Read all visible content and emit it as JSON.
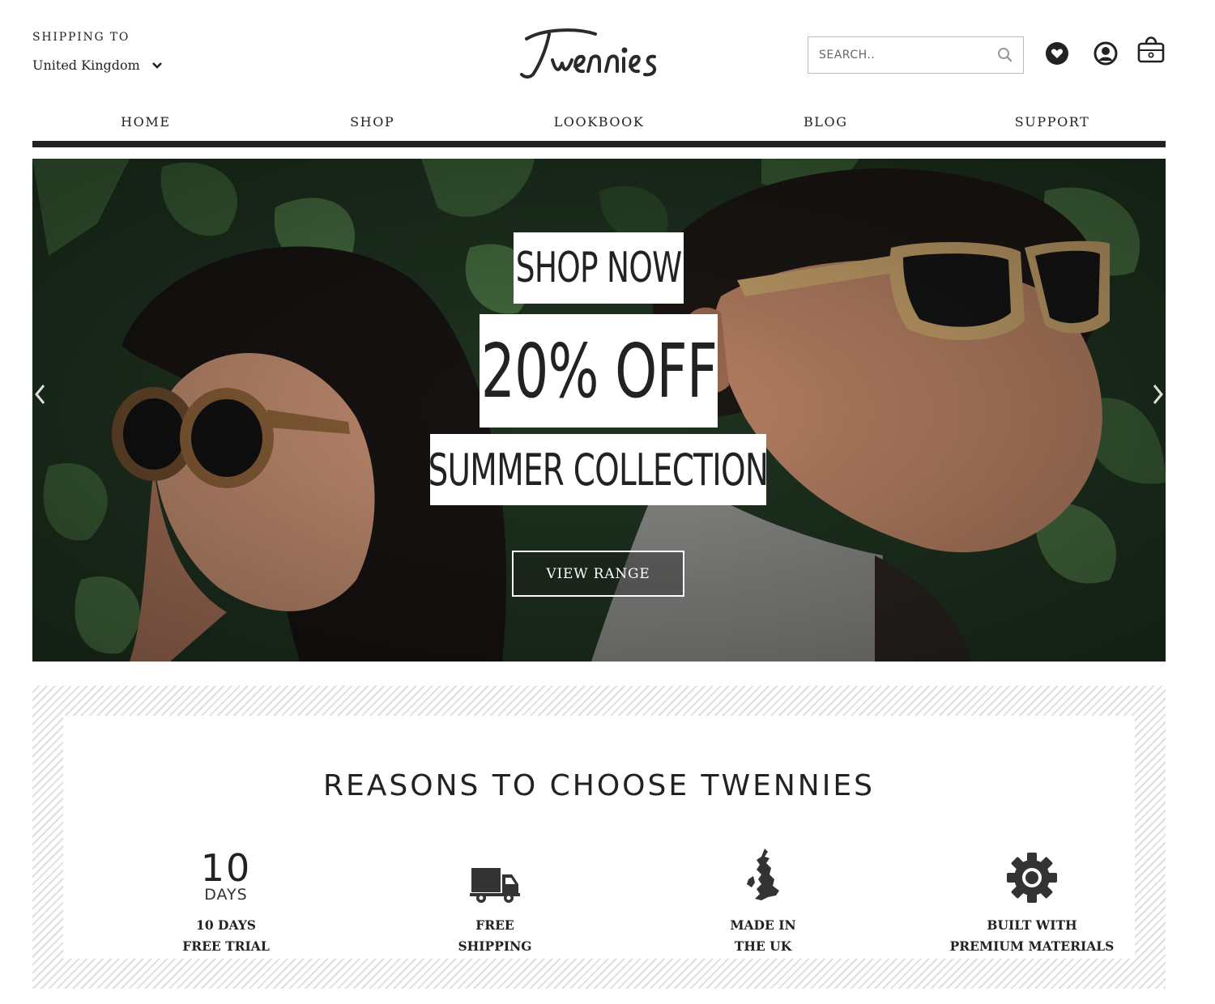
{
  "header": {
    "shipping_label": "SHIPPING TO",
    "country": "United Kingdom",
    "logo_text": "Twennies",
    "search_placeholder": "SEARCH.."
  },
  "nav": {
    "items": [
      "HOME",
      "SHOP",
      "LOOKBOOK",
      "BLOG",
      "SUPPORT"
    ]
  },
  "hero": {
    "line1": "SHOP NOW",
    "line2": "20% OFF",
    "line3": "SUMMER COLLECTION",
    "cta": "VIEW RANGE"
  },
  "reasons": {
    "title": "REASONS TO CHOOSE TWENNIES",
    "days_number": "10",
    "days_label": "DAYS",
    "features": [
      {
        "icon": "ten-days-icon",
        "line1": "10 DAYS",
        "line2": "FREE TRIAL"
      },
      {
        "icon": "truck-icon",
        "line1": "FREE",
        "line2": "SHIPPING"
      },
      {
        "icon": "uk-map-icon",
        "line1": "MADE IN",
        "line2": "THE UK"
      },
      {
        "icon": "gear-icon",
        "line1": "BUILT WITH",
        "line2": "PREMIUM MATERIALS"
      }
    ]
  },
  "colors": {
    "text": "#222222",
    "nav_bar": "#222222",
    "stripe": "#dddddd",
    "foliage": "#2f4a2c"
  }
}
